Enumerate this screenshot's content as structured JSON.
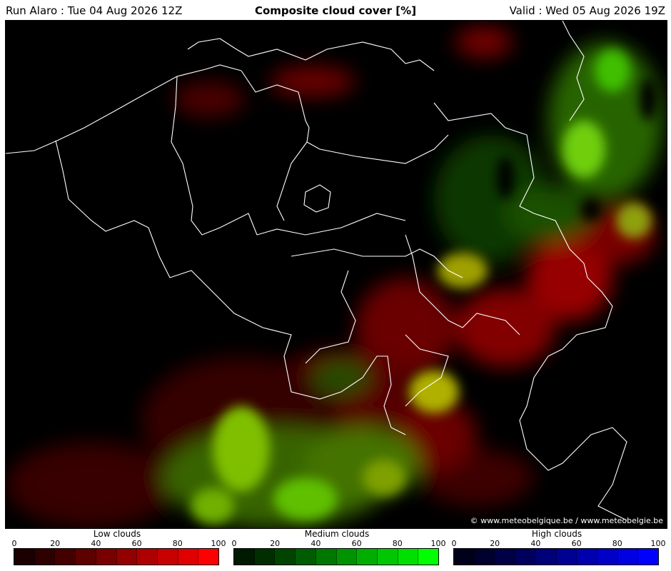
{
  "header": {
    "run": "Run Alaro : Tue 04 Aug 2026 12Z",
    "title": "Composite cloud cover [%]",
    "valid": "Valid : Wed 05 Aug 2026 19Z"
  },
  "map": {
    "copyright": "© www.meteobelgique.be / www.meteobelgie.be"
  },
  "legends": [
    {
      "title": "Low clouds",
      "ticks": [
        "0",
        "20",
        "40",
        "60",
        "80",
        "100"
      ],
      "colors": [
        "#1a0000",
        "#2e0000",
        "#440000",
        "#5c0000",
        "#780000",
        "#930000",
        "#ae0000",
        "#c70000",
        "#e00000",
        "#ff0000"
      ]
    },
    {
      "title": "Medium clouds",
      "ticks": [
        "0",
        "20",
        "40",
        "60",
        "80",
        "100"
      ],
      "colors": [
        "#001a00",
        "#002e00",
        "#004400",
        "#005c00",
        "#007800",
        "#009300",
        "#00ae00",
        "#00c700",
        "#00e000",
        "#00ff00"
      ]
    },
    {
      "title": "High clouds",
      "ticks": [
        "0",
        "20",
        "40",
        "60",
        "80",
        "100"
      ],
      "colors": [
        "#00001a",
        "#00002e",
        "#000044",
        "#00005c",
        "#000078",
        "#000093",
        "#0000ae",
        "#0000c7",
        "#0000e0",
        "#0000ff"
      ]
    }
  ]
}
